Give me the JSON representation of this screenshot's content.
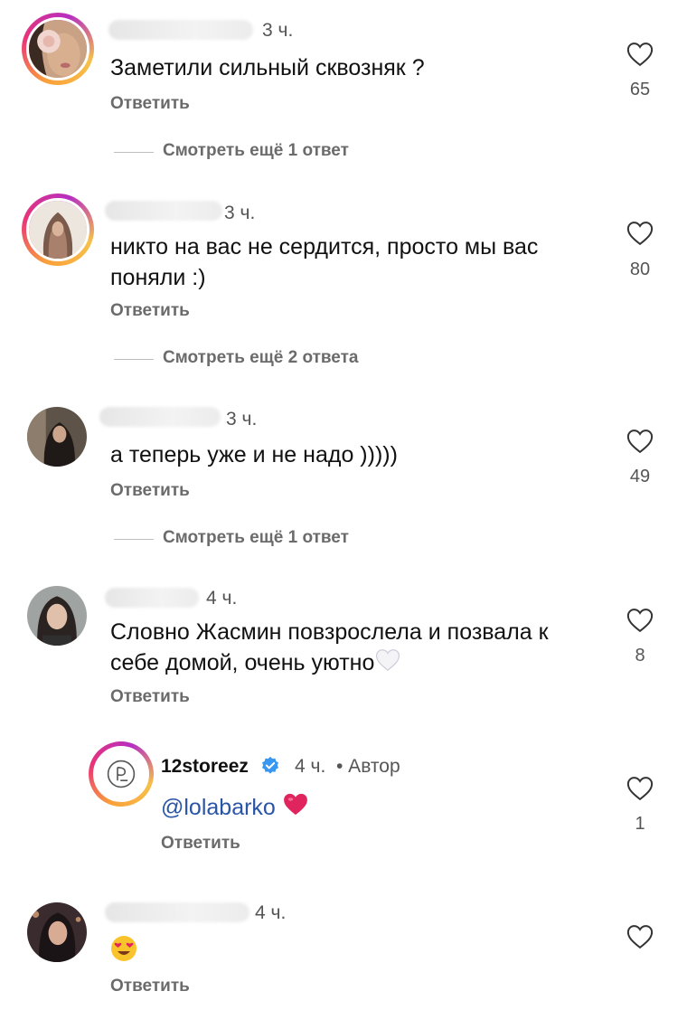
{
  "comments": [
    {
      "time": "3 ч.",
      "text": "Заметили сильный сквозняк ?",
      "reply_label": "Ответить",
      "likes": "65",
      "more_replies": "Смотреть ещё 1 ответ"
    },
    {
      "time": "3 ч.",
      "text_line1": "никто на вас не сердится, просто мы вас",
      "text_line2": "поняли :)",
      "reply_label": "Ответить",
      "likes": "80",
      "more_replies": "Смотреть ещё 2 ответа"
    },
    {
      "time": "3 ч.",
      "text": "а теперь уже и не надо )))))",
      "reply_label": "Ответить",
      "likes": "49",
      "more_replies": "Смотреть ещё 1 ответ"
    },
    {
      "time": "4 ч.",
      "text_line1": "Словно Жасмин повзрослела и позвала к",
      "text_line2": "себе домой, очень уютно",
      "emoji": "white-heart",
      "reply_label": "Ответить",
      "likes": "8"
    },
    {
      "author": "12storeez",
      "time": "4 ч.",
      "author_tag": "• Автор",
      "mention": "@lolabarko",
      "emoji": "red-heart",
      "reply_label": "Ответить",
      "likes": "1"
    },
    {
      "time": "4 ч.",
      "emoji": "heart-eyes-face",
      "reply_label": "Ответить"
    }
  ],
  "colors": {
    "text": "#111111",
    "secondary": "#6b6b6b",
    "mention": "#2a55a7",
    "verified": "#3897f0",
    "red_heart": "#e0245e"
  }
}
